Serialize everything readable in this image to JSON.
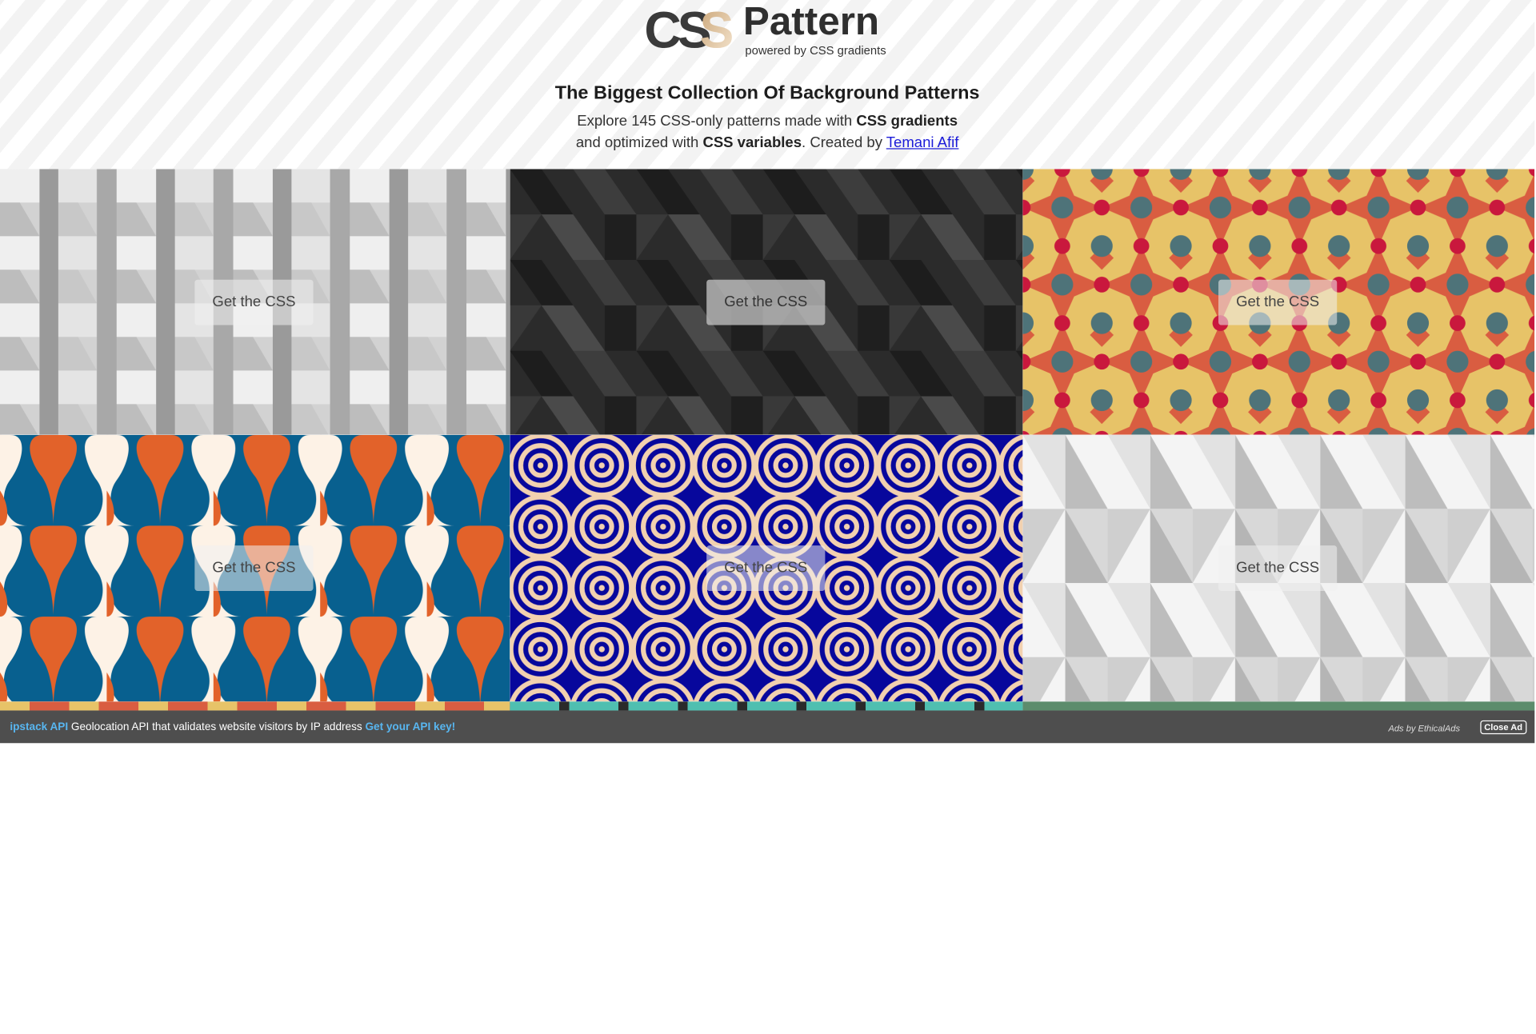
{
  "header": {
    "logo_text": "Pattern",
    "logo_mark": "CSS",
    "logo_sub": "powered by CSS gradients",
    "headline": "The Biggest Collection Of Background Patterns",
    "intro_1": "Explore 145 CSS-only patterns made with ",
    "intro_1_bold": "CSS gradients",
    "intro_2": "and optimized with ",
    "intro_2_bold": "CSS variables",
    "intro_2_rest": ". Created by ",
    "author": "Temani Afif"
  },
  "tiles": [
    {
      "button": "Get the CSS",
      "pattern": "3d-y-blocks"
    },
    {
      "button": "Get the CSS",
      "pattern": "dark-cubes"
    },
    {
      "button": "Get the CSS",
      "pattern": "stars-and-dots"
    },
    {
      "button": "Get the CSS",
      "pattern": "ogee-waves"
    },
    {
      "button": "Get the CSS",
      "pattern": "concentric-circles"
    },
    {
      "button": "Get the CSS",
      "pattern": "3d-pyramids"
    }
  ],
  "colors": {
    "gray_light": "#e8e8e8",
    "dark": "#2a2a2a",
    "red": "#d95d41",
    "teal": "#4e7379",
    "crimson": "#c9183d",
    "gold": "#e7c368",
    "orange": "#e2622a",
    "blue": "#08608f",
    "cream": "#fdf2e6",
    "navy": "#07079c",
    "peach": "#f2d1b0"
  },
  "ad": {
    "brand": "ipstack API",
    "text": " Geolocation API that validates website visitors by IP address ",
    "cta": "Get your API key!",
    "by": "Ads by EthicalAds",
    "close": "Close Ad"
  }
}
